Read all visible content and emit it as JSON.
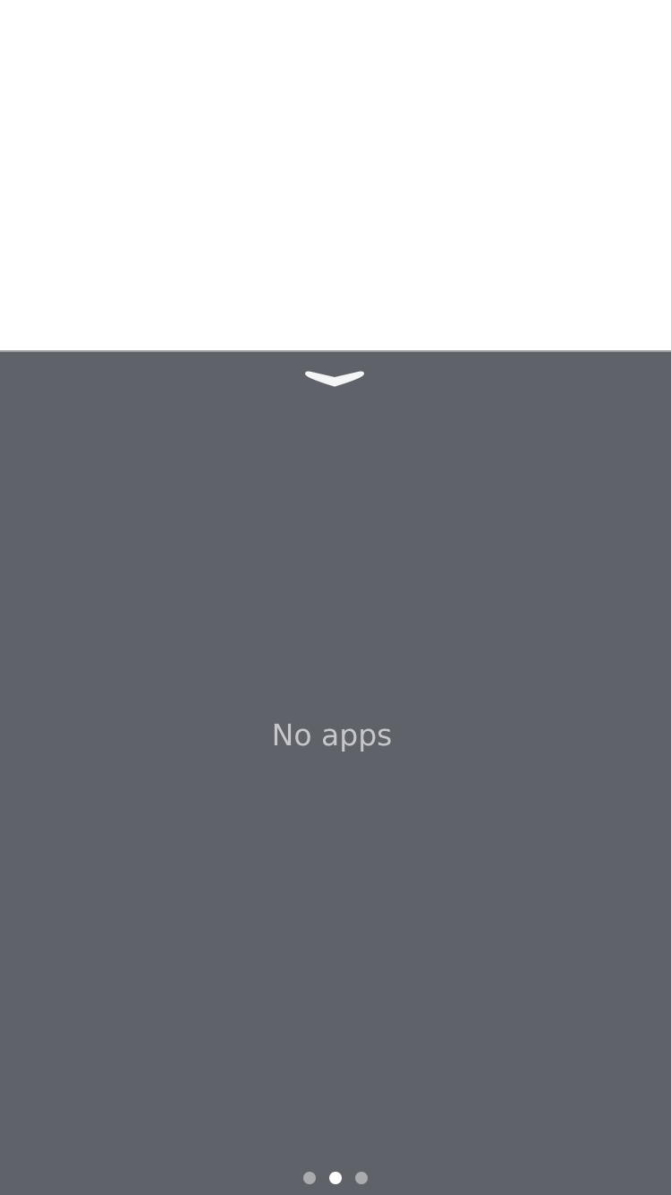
{
  "top_area": {},
  "drawer": {
    "handle_icon": "chevron-down-icon",
    "empty_message": "No apps",
    "page_indicator": {
      "count": 3,
      "active_index": 1
    }
  },
  "colors": {
    "panel_background": "#5f6369",
    "message_text": "#c5c7ca",
    "dot_inactive": "#a9abaf",
    "dot_active": "#ffffff"
  }
}
